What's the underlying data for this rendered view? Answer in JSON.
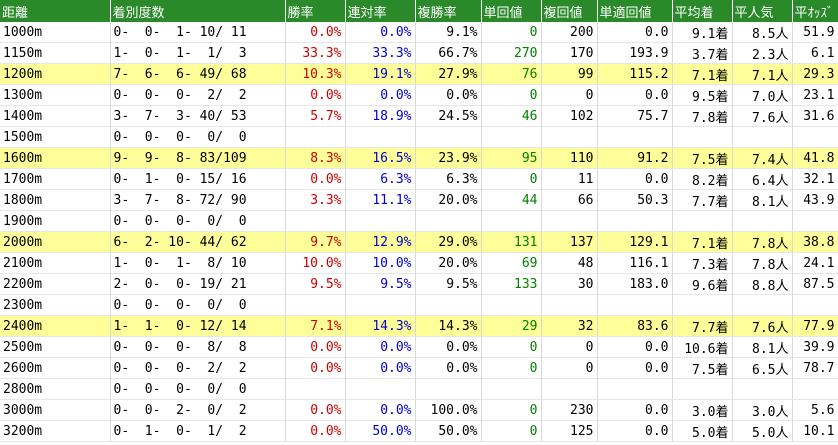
{
  "header": [
    "距離",
    "着別度数",
    "勝率",
    "連対率",
    "複勝率",
    "単回値",
    "複回値",
    "単適回値",
    "平均着",
    "平人気",
    "平ｵｯｽﾞ"
  ],
  "colors": {
    "header_bg": "#2a8a2a",
    "highlight_bg": "#ffff99",
    "win_rate": "#cc0000",
    "ren_rate": "#0000cc",
    "tan_val": "#008000"
  },
  "rows": [
    {
      "dist": "1000m",
      "rec": "0-  0-  1- 10/ 11",
      "win": "0.0%",
      "ren": "0.0%",
      "fuk": "9.1%",
      "tan": "0",
      "fkk": "200",
      "tkk": "0.0",
      "avg": "9.1着",
      "pop": "8.5人",
      "odds": "51.9",
      "hl": false
    },
    {
      "dist": "1150m",
      "rec": "1-  0-  1-  1/  3",
      "win": "33.3%",
      "ren": "33.3%",
      "fuk": "66.7%",
      "tan": "270",
      "fkk": "170",
      "tkk": "193.9",
      "avg": "3.7着",
      "pop": "2.3人",
      "odds": "6.1",
      "hl": false
    },
    {
      "dist": "1200m",
      "rec": "7-  6-  6- 49/ 68",
      "win": "10.3%",
      "ren": "19.1%",
      "fuk": "27.9%",
      "tan": "76",
      "fkk": "99",
      "tkk": "115.2",
      "avg": "7.1着",
      "pop": "7.1人",
      "odds": "29.3",
      "hl": true
    },
    {
      "dist": "1300m",
      "rec": "0-  0-  0-  2/  2",
      "win": "0.0%",
      "ren": "0.0%",
      "fuk": "0.0%",
      "tan": "0",
      "fkk": "0",
      "tkk": "0.0",
      "avg": "9.5着",
      "pop": "7.0人",
      "odds": "23.1",
      "hl": false
    },
    {
      "dist": "1400m",
      "rec": "3-  7-  3- 40/ 53",
      "win": "5.7%",
      "ren": "18.9%",
      "fuk": "24.5%",
      "tan": "46",
      "fkk": "102",
      "tkk": "75.7",
      "avg": "7.8着",
      "pop": "7.6人",
      "odds": "31.6",
      "hl": false
    },
    {
      "dist": "1500m",
      "rec": "0-  0-  0-  0/  0",
      "win": "",
      "ren": "",
      "fuk": "",
      "tan": "",
      "fkk": "",
      "tkk": "",
      "avg": "",
      "pop": "",
      "odds": "",
      "hl": false
    },
    {
      "dist": "1600m",
      "rec": "9-  9-  8- 83/109",
      "win": "8.3%",
      "ren": "16.5%",
      "fuk": "23.9%",
      "tan": "95",
      "fkk": "110",
      "tkk": "91.2",
      "avg": "7.5着",
      "pop": "7.4人",
      "odds": "41.8",
      "hl": true
    },
    {
      "dist": "1700m",
      "rec": "0-  1-  0- 15/ 16",
      "win": "0.0%",
      "ren": "6.3%",
      "fuk": "6.3%",
      "tan": "0",
      "fkk": "11",
      "tkk": "0.0",
      "avg": "8.2着",
      "pop": "6.4人",
      "odds": "32.1",
      "hl": false
    },
    {
      "dist": "1800m",
      "rec": "3-  7-  8- 72/ 90",
      "win": "3.3%",
      "ren": "11.1%",
      "fuk": "20.0%",
      "tan": "44",
      "fkk": "66",
      "tkk": "50.3",
      "avg": "7.7着",
      "pop": "8.1人",
      "odds": "43.9",
      "hl": false
    },
    {
      "dist": "1900m",
      "rec": "0-  0-  0-  0/  0",
      "win": "",
      "ren": "",
      "fuk": "",
      "tan": "",
      "fkk": "",
      "tkk": "",
      "avg": "",
      "pop": "",
      "odds": "",
      "hl": false
    },
    {
      "dist": "2000m",
      "rec": "6-  2- 10- 44/ 62",
      "win": "9.7%",
      "ren": "12.9%",
      "fuk": "29.0%",
      "tan": "131",
      "fkk": "137",
      "tkk": "129.1",
      "avg": "7.1着",
      "pop": "7.8人",
      "odds": "38.8",
      "hl": true
    },
    {
      "dist": "2100m",
      "rec": "1-  0-  1-  8/ 10",
      "win": "10.0%",
      "ren": "10.0%",
      "fuk": "20.0%",
      "tan": "69",
      "fkk": "48",
      "tkk": "116.1",
      "avg": "7.3着",
      "pop": "7.8人",
      "odds": "24.1",
      "hl": false
    },
    {
      "dist": "2200m",
      "rec": "2-  0-  0- 19/ 21",
      "win": "9.5%",
      "ren": "9.5%",
      "fuk": "9.5%",
      "tan": "133",
      "fkk": "30",
      "tkk": "183.0",
      "avg": "9.6着",
      "pop": "8.8人",
      "odds": "87.5",
      "hl": false
    },
    {
      "dist": "2300m",
      "rec": "0-  0-  0-  0/  0",
      "win": "",
      "ren": "",
      "fuk": "",
      "tan": "",
      "fkk": "",
      "tkk": "",
      "avg": "",
      "pop": "",
      "odds": "",
      "hl": false
    },
    {
      "dist": "2400m",
      "rec": "1-  1-  0- 12/ 14",
      "win": "7.1%",
      "ren": "14.3%",
      "fuk": "14.3%",
      "tan": "29",
      "fkk": "32",
      "tkk": "83.6",
      "avg": "7.7着",
      "pop": "7.6人",
      "odds": "77.9",
      "hl": true
    },
    {
      "dist": "2500m",
      "rec": "0-  0-  0-  8/  8",
      "win": "0.0%",
      "ren": "0.0%",
      "fuk": "0.0%",
      "tan": "0",
      "fkk": "0",
      "tkk": "0.0",
      "avg": "10.6着",
      "pop": "8.1人",
      "odds": "39.9",
      "hl": false
    },
    {
      "dist": "2600m",
      "rec": "0-  0-  0-  2/  2",
      "win": "0.0%",
      "ren": "0.0%",
      "fuk": "0.0%",
      "tan": "0",
      "fkk": "0",
      "tkk": "0.0",
      "avg": "7.5着",
      "pop": "6.5人",
      "odds": "78.7",
      "hl": false
    },
    {
      "dist": "2800m",
      "rec": "0-  0-  0-  0/  0",
      "win": "",
      "ren": "",
      "fuk": "",
      "tan": "",
      "fkk": "",
      "tkk": "",
      "avg": "",
      "pop": "",
      "odds": "",
      "hl": false
    },
    {
      "dist": "3000m",
      "rec": "0-  0-  2-  0/  2",
      "win": "0.0%",
      "ren": "0.0%",
      "fuk": "100.0%",
      "tan": "0",
      "fkk": "230",
      "tkk": "0.0",
      "avg": "3.0着",
      "pop": "3.0人",
      "odds": "5.6",
      "hl": false
    },
    {
      "dist": "3200m",
      "rec": "0-  1-  0-  1/  2",
      "win": "0.0%",
      "ren": "50.0%",
      "fuk": "50.0%",
      "tan": "0",
      "fkk": "125",
      "tkk": "0.0",
      "avg": "5.0着",
      "pop": "5.0人",
      "odds": "10.1",
      "hl": false
    }
  ]
}
